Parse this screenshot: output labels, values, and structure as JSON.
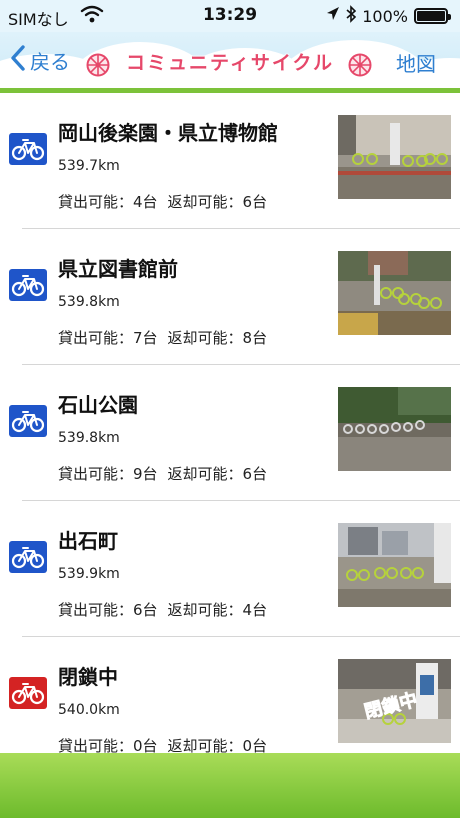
{
  "status_bar": {
    "carrier": "SIMなし",
    "time": "13:29",
    "battery": "100%"
  },
  "nav": {
    "back_label": "戻る",
    "title": "コミュニティサイクル",
    "map_label": "地図"
  },
  "stations": [
    {
      "name": "岡山後楽園・県立博物館",
      "distance": "539.7km",
      "lend": "貸出可能：4台",
      "return": "返却可能：6台",
      "status": "open"
    },
    {
      "name": "県立図書館前",
      "distance": "539.8km",
      "lend": "貸出可能：7台",
      "return": "返却可能：8台",
      "status": "open"
    },
    {
      "name": "石山公園",
      "distance": "539.8km",
      "lend": "貸出可能：9台",
      "return": "返却可能：6台",
      "status": "open"
    },
    {
      "name": "出石町",
      "distance": "539.9km",
      "lend": "貸出可能：6台",
      "return": "返却可能：4台",
      "status": "open"
    },
    {
      "name": "閉鎖中",
      "distance": "540.0km",
      "lend": "貸出可能：0台",
      "return": "返却可能：0台",
      "status": "closed",
      "photo_overlay": "閉鎖中"
    }
  ],
  "colors": {
    "bike_icon_open": "#1f55c9",
    "bike_icon_closed": "#d42323",
    "link_blue": "#2f7fd0",
    "title_pink": "#e6486a",
    "bottom_green": "#7cc23a"
  }
}
